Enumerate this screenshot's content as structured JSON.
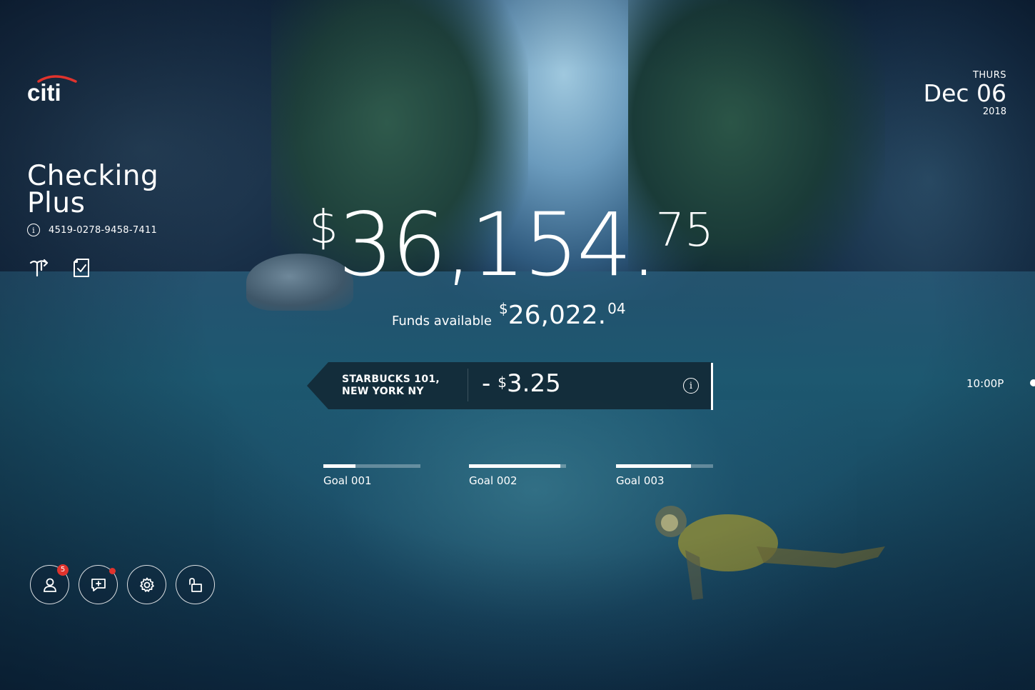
{
  "brand": {
    "logo_text": "citi",
    "accent_color": "#e0332d"
  },
  "account": {
    "name_line1": "Checking",
    "name_line2": "Plus",
    "number": "4519-0278-9458-7411",
    "icons": [
      "transfer-icon",
      "check-deposit-icon"
    ]
  },
  "date": {
    "day_of_week": "THURS",
    "month_day": "Dec 06",
    "year": "2018"
  },
  "balance": {
    "currency": "$",
    "whole": "36,154",
    "decimal": ".",
    "cents": "75"
  },
  "funds_available": {
    "label": "Funds available",
    "currency": "$",
    "whole": "26,022.",
    "cents": "04"
  },
  "transaction": {
    "merchant_line1": "STARBUCKS 101,",
    "merchant_line2": "NEW YORK NY",
    "sign": "-",
    "currency": "$",
    "amount": "3.25"
  },
  "timeline": {
    "time": "10:00P"
  },
  "goals": [
    {
      "label": "Goal 001",
      "progress": 0.33
    },
    {
      "label": "Goal 002",
      "progress": 0.94
    },
    {
      "label": "Goal 003",
      "progress": 0.77
    }
  ],
  "controls": {
    "profile_badge": "5",
    "items": [
      "profile-icon",
      "message-icon",
      "settings-icon",
      "lock-icon"
    ]
  }
}
